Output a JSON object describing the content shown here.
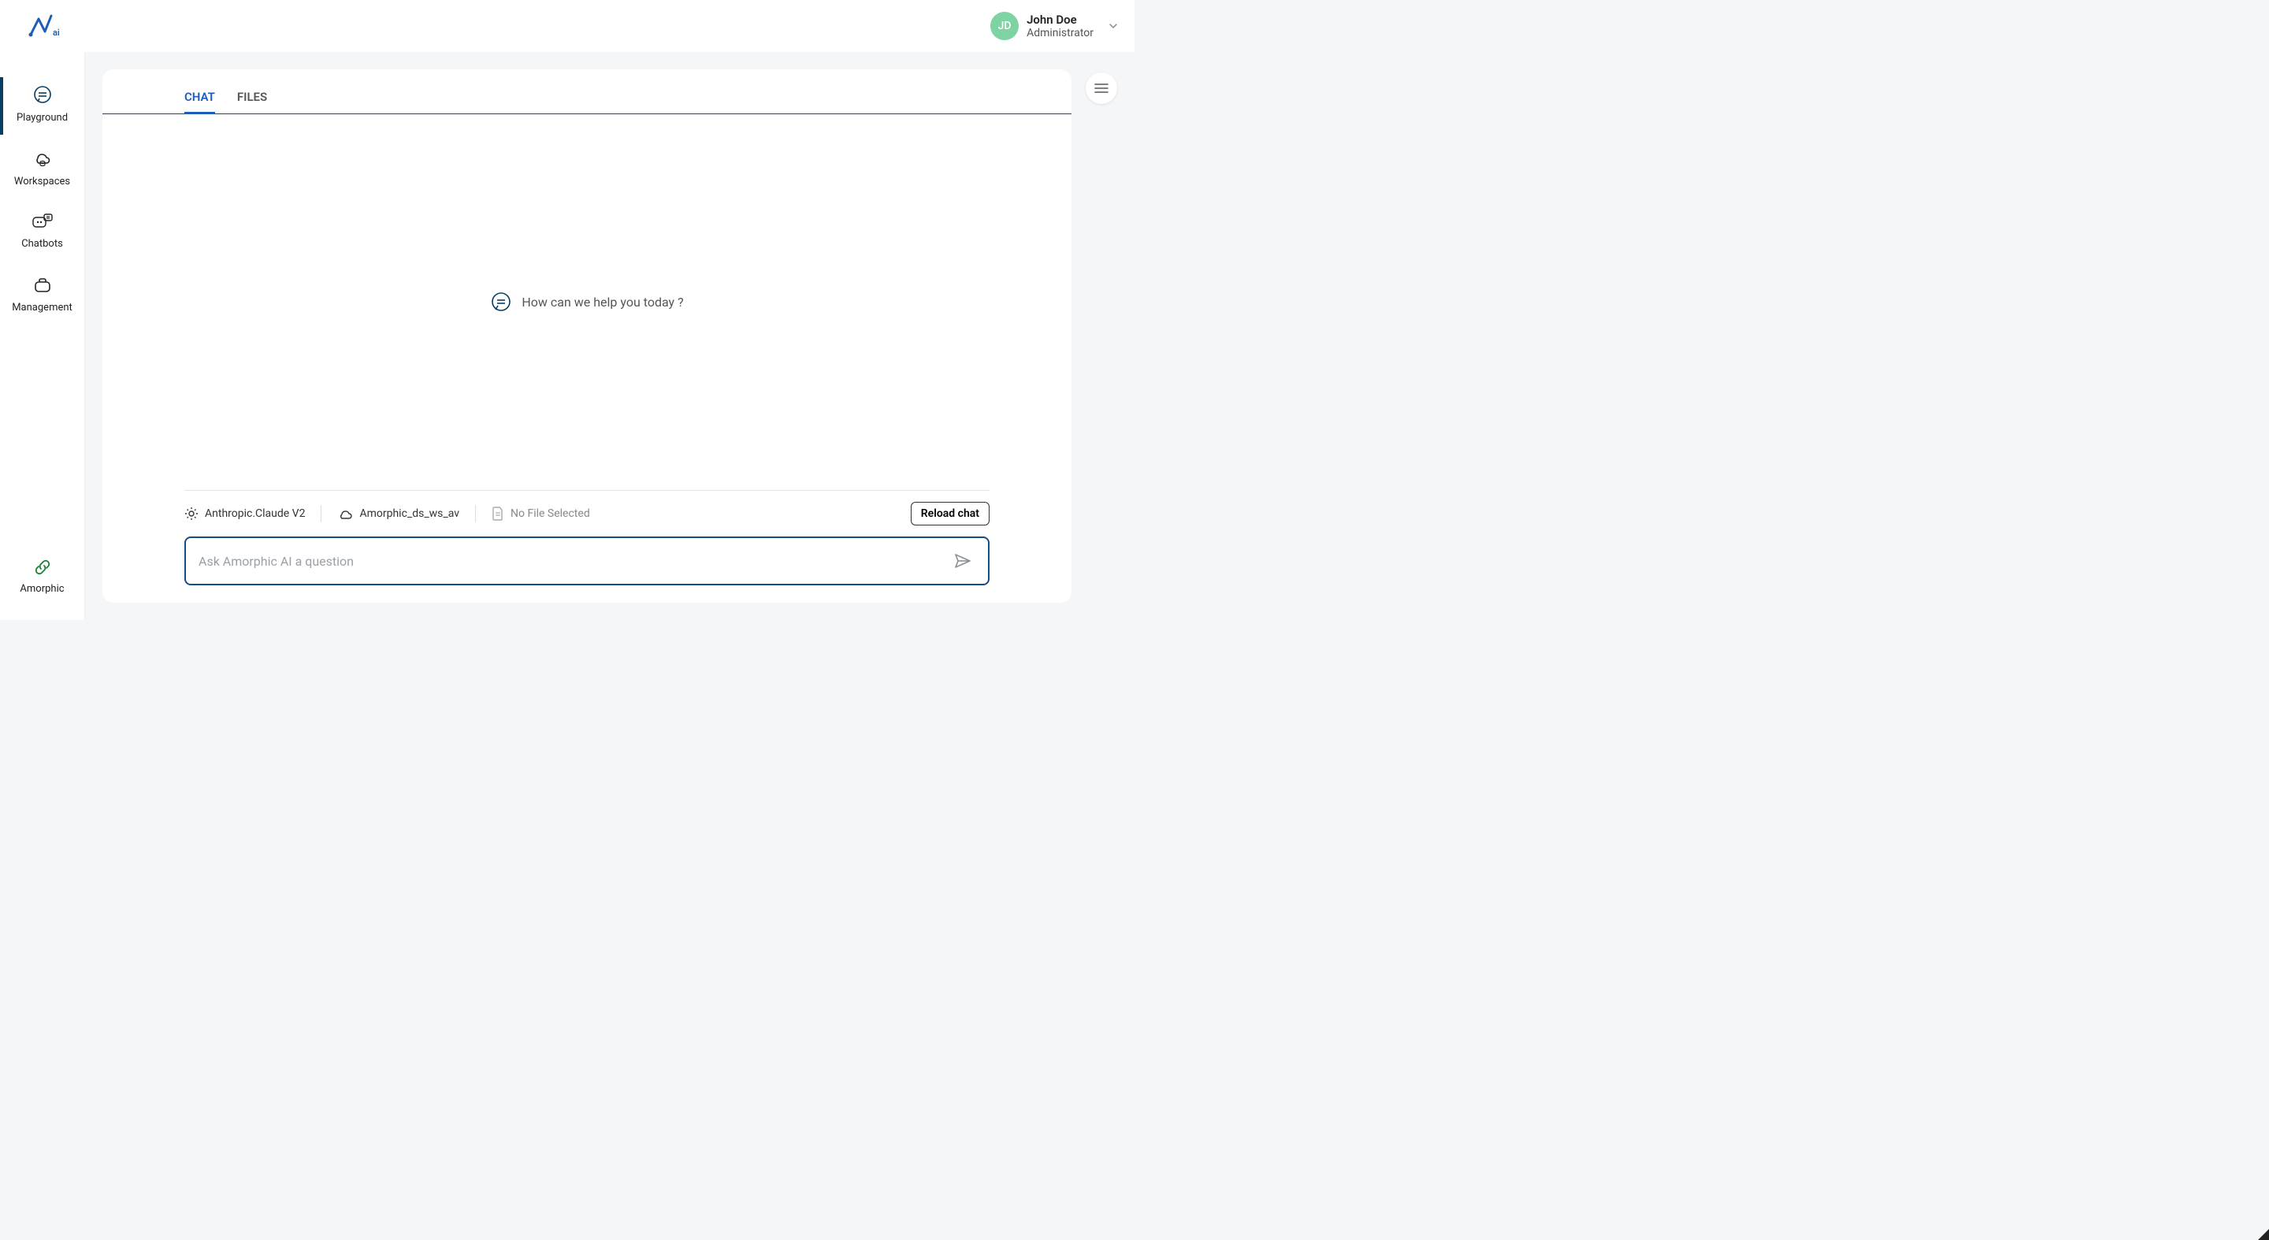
{
  "header": {
    "user": {
      "initials": "JD",
      "name": "John Doe",
      "role": "Administrator"
    }
  },
  "sidebar": {
    "items": [
      {
        "key": "playground",
        "label": "Playground",
        "active": true
      },
      {
        "key": "workspaces",
        "label": "Workspaces",
        "active": false
      },
      {
        "key": "chatbots",
        "label": "Chatbots",
        "active": false
      },
      {
        "key": "management",
        "label": "Management",
        "active": false
      }
    ],
    "bottom": {
      "label": "Amorphic"
    }
  },
  "tabs": {
    "items": [
      {
        "key": "chat",
        "label": "CHAT",
        "active": true
      },
      {
        "key": "files",
        "label": "FILES",
        "active": false
      }
    ]
  },
  "chat": {
    "empty_message": "How can we help you today ?",
    "input_placeholder": "Ask Amorphic AI a question"
  },
  "footer": {
    "model": "Anthropic.Claude V2",
    "workspace": "Amorphic_ds_ws_av",
    "file_status": "No File Selected",
    "reload_label": "Reload chat"
  }
}
